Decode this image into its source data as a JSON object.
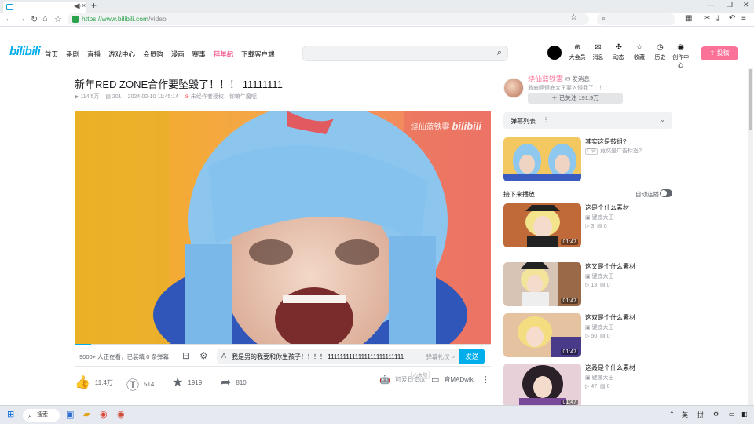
{
  "browser": {
    "tab_title": "",
    "url_host": "https://www.bilibili.com",
    "url_path": "/video"
  },
  "header": {
    "logo": "bilibili",
    "nav": [
      "首页",
      "番剧",
      "直播",
      "游戏中心",
      "会员购",
      "漫画",
      "赛事",
      "拜年纪",
      "下载客户端"
    ],
    "icons": [
      {
        "name": "大会员",
        "icon": "vip-icon"
      },
      {
        "name": "消息",
        "icon": "message-icon"
      },
      {
        "name": "动态",
        "icon": "dynamic-icon"
      },
      {
        "name": "收藏",
        "icon": "favorite-icon"
      },
      {
        "name": "历史",
        "icon": "history-icon"
      },
      {
        "name": "创作中心",
        "icon": "creator-icon"
      }
    ],
    "upload": "投稿"
  },
  "video": {
    "title": "新年RED ZONE合作要坠毁了！！！ 11111111",
    "views": "114.5万",
    "danmaku_count": "201",
    "date": "2024-02-10 11:45:14",
    "notice": "未经作者授权，你嘛牛魔呢",
    "watermark_user": "烧仙蓝铁雾",
    "watermark_logo": "bilibili",
    "progress": 0.04
  },
  "danmaku_bar": {
    "watching": "9000+ 人正在看，已装填 0 条弹幕",
    "input_text": "我是男的我要和你生孩子！！！！ 1111111111111111111111111",
    "gift": "弹幕礼仪 >",
    "send": "发送"
  },
  "actions": {
    "like": "11.4万",
    "coin": "514",
    "fav": "1919",
    "share": "810",
    "bot_badge": "心太阳",
    "bot": "可爱日 Bot",
    "wiki": "音MADwiki"
  },
  "up": {
    "name": "烧仙蓝铁雾",
    "message": "发消息",
    "desc": "救命啊键底大王要入侵我了！！！",
    "follow": "已关注 191.9万"
  },
  "sidebar": {
    "danmaku_list": "弹幕列表",
    "ad": {
      "title": "其实这是鼓组?",
      "tag": "广告",
      "sub": "竟然是广告标签?"
    },
    "next_label": "接下来播放",
    "autoplay_label": "自动连播",
    "items": [
      {
        "title": "这是个什么素材",
        "author": "键底大王",
        "plays": "3",
        "danmaku": "0",
        "duration": "01:47"
      },
      {
        "title": "这又是个什么素材",
        "author": "键底大王",
        "plays": "13",
        "danmaku": "0",
        "duration": "01:47"
      },
      {
        "title": "这双是个什么素材",
        "author": "键底大王",
        "plays": "50",
        "danmaku": "0",
        "duration": "01:47"
      },
      {
        "title": "这叒是个什么素材",
        "author": "键底大王",
        "plays": "47",
        "danmaku": "0",
        "duration": "01:47"
      }
    ]
  },
  "taskbar": {
    "search": "搜索",
    "ime1": "英",
    "ime2": "拼"
  }
}
